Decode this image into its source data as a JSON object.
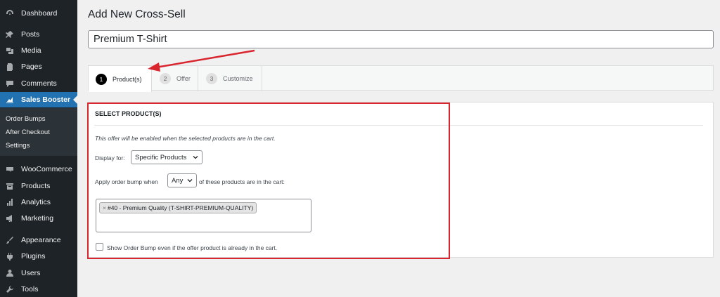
{
  "sidebar": {
    "items": [
      {
        "label": "Dashboard",
        "icon": "dashboard-icon"
      },
      {
        "label": "Posts",
        "icon": "pin-icon"
      },
      {
        "label": "Media",
        "icon": "media-icon"
      },
      {
        "label": "Pages",
        "icon": "pages-icon"
      },
      {
        "label": "Comments",
        "icon": "comment-icon"
      },
      {
        "label": "Sales Booster",
        "icon": "chart-icon"
      },
      {
        "label": "WooCommerce",
        "icon": "woo-icon"
      },
      {
        "label": "Products",
        "icon": "archive-icon"
      },
      {
        "label": "Analytics",
        "icon": "bar-chart-icon"
      },
      {
        "label": "Marketing",
        "icon": "megaphone-icon"
      },
      {
        "label": "Appearance",
        "icon": "paintbrush-icon"
      },
      {
        "label": "Plugins",
        "icon": "plugin-icon"
      },
      {
        "label": "Users",
        "icon": "user-icon"
      },
      {
        "label": "Tools",
        "icon": "wrench-icon"
      }
    ],
    "active": "Sales Booster",
    "submenu": [
      "Order Bumps",
      "After Checkout",
      "Settings"
    ]
  },
  "header": {
    "title": "Add New Cross-Sell",
    "title_input_value": "Premium T-Shirt"
  },
  "tabs": [
    {
      "num": "1",
      "label": "Product(s)"
    },
    {
      "num": "2",
      "label": "Offer"
    },
    {
      "num": "3",
      "label": "Customize"
    }
  ],
  "form": {
    "section_title": "SELECT PRODUCT(S)",
    "description": "This offer will be enabled when the selected products are in the cart.",
    "display_for_label": "Display for:",
    "display_for_value": "Specific Products",
    "apply_prefix": "Apply order bump when",
    "apply_value": "Any",
    "apply_suffix": "of these products are in the cart:",
    "chip_remove": "×",
    "selected_product": "#40 - Premium Quality (T-SHIRT-PREMIUM-QUALITY)",
    "checkbox_label": "Show Order Bump even if the offer product is already in the cart.",
    "checkbox_checked": false
  },
  "colors": {
    "sidebar_bg": "#1d2327",
    "active_bg": "#2271b1",
    "highlight": "#d9262e"
  }
}
